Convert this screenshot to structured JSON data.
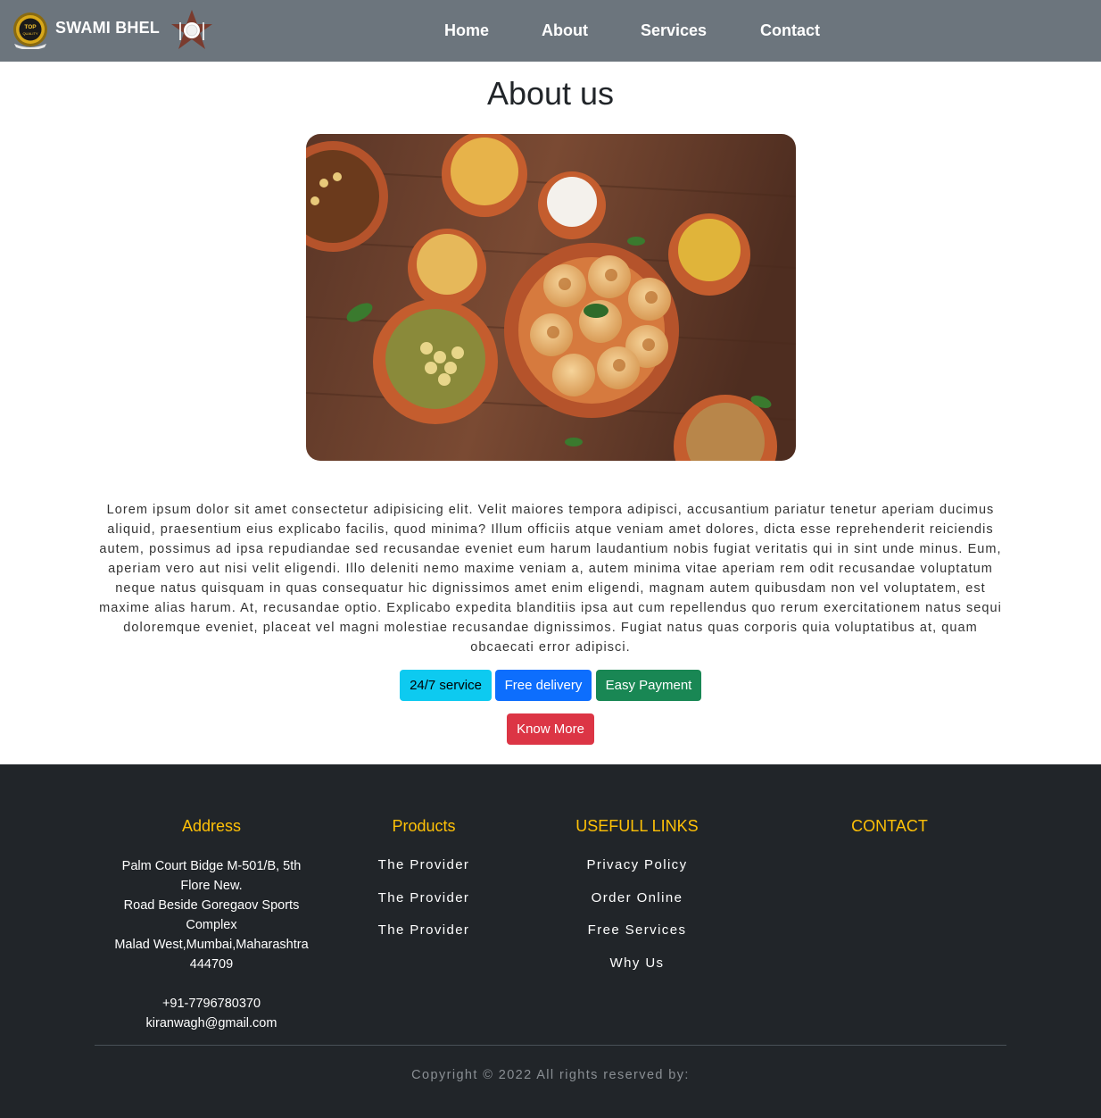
{
  "navbar": {
    "brand": "SWAMI BHEL",
    "badge_text_top": "TOP",
    "badge_text_bottom": "QUALITY",
    "links": [
      "Home",
      "About",
      "Services",
      "Contact"
    ]
  },
  "about": {
    "title": "About us",
    "paragraph": "Lorem ipsum dolor sit amet consectetur adipisicing elit. Velit maiores tempora adipisci, accusantium pariatur tenetur aperiam ducimus aliquid, praesentium eius explicabo facilis, quod minima? Illum officiis atque veniam amet dolores, dicta esse reprehenderit reiciendis autem, possimus ad ipsa repudiandae sed recusandae eveniet eum harum laudantium nobis fugiat veritatis qui in sint unde minus. Eum, aperiam vero aut nisi velit eligendi. Illo deleniti nemo maxime veniam a, autem minima vitae aperiam rem odit recusandae voluptatum neque natus quisquam in quas consequatur hic dignissimos amet enim eligendi, magnam autem quibusdam non vel voluptatem, est maxime alias harum. At, recusandae optio. Explicabo expedita blanditiis ipsa aut cum repellendus quo rerum exercitationem natus sequi doloremque eveniet, placeat vel magni molestiae recusandae dignissimos. Fugiat natus quas corporis quia voluptatibus at, quam obcaecati error adipisci.",
    "badges": [
      "24/7 service",
      "Free delivery",
      "Easy Payment"
    ],
    "cta": "Know More"
  },
  "footer": {
    "address_heading": "Address",
    "address_lines": [
      "Palm Court Bidge M-501/B, 5th",
      "Flore New.",
      "Road Beside Goregaov Sports",
      "Complex",
      "Malad West,Mumbai,Maharashtra",
      "444709"
    ],
    "phone": "+91-7796780370",
    "email": "kiranwagh@gmail.com",
    "products_heading": "Products",
    "products": [
      "The Provider",
      "The Provider",
      "The Provider"
    ],
    "links_heading": "USEFULL LINKS",
    "links": [
      "Privacy Policy",
      "Order Online",
      "Free Services",
      "Why Us"
    ],
    "contact_heading": "CONTACT",
    "copyright": "Copyright © 2022 All rights reserved by:"
  },
  "colors": {
    "navbar": "#6c757d",
    "footer": "#212529",
    "heading_accent": "#ffc107",
    "info": "#0dcaf0",
    "primary": "#0d6efd",
    "success": "#198754",
    "danger": "#dc3545"
  }
}
